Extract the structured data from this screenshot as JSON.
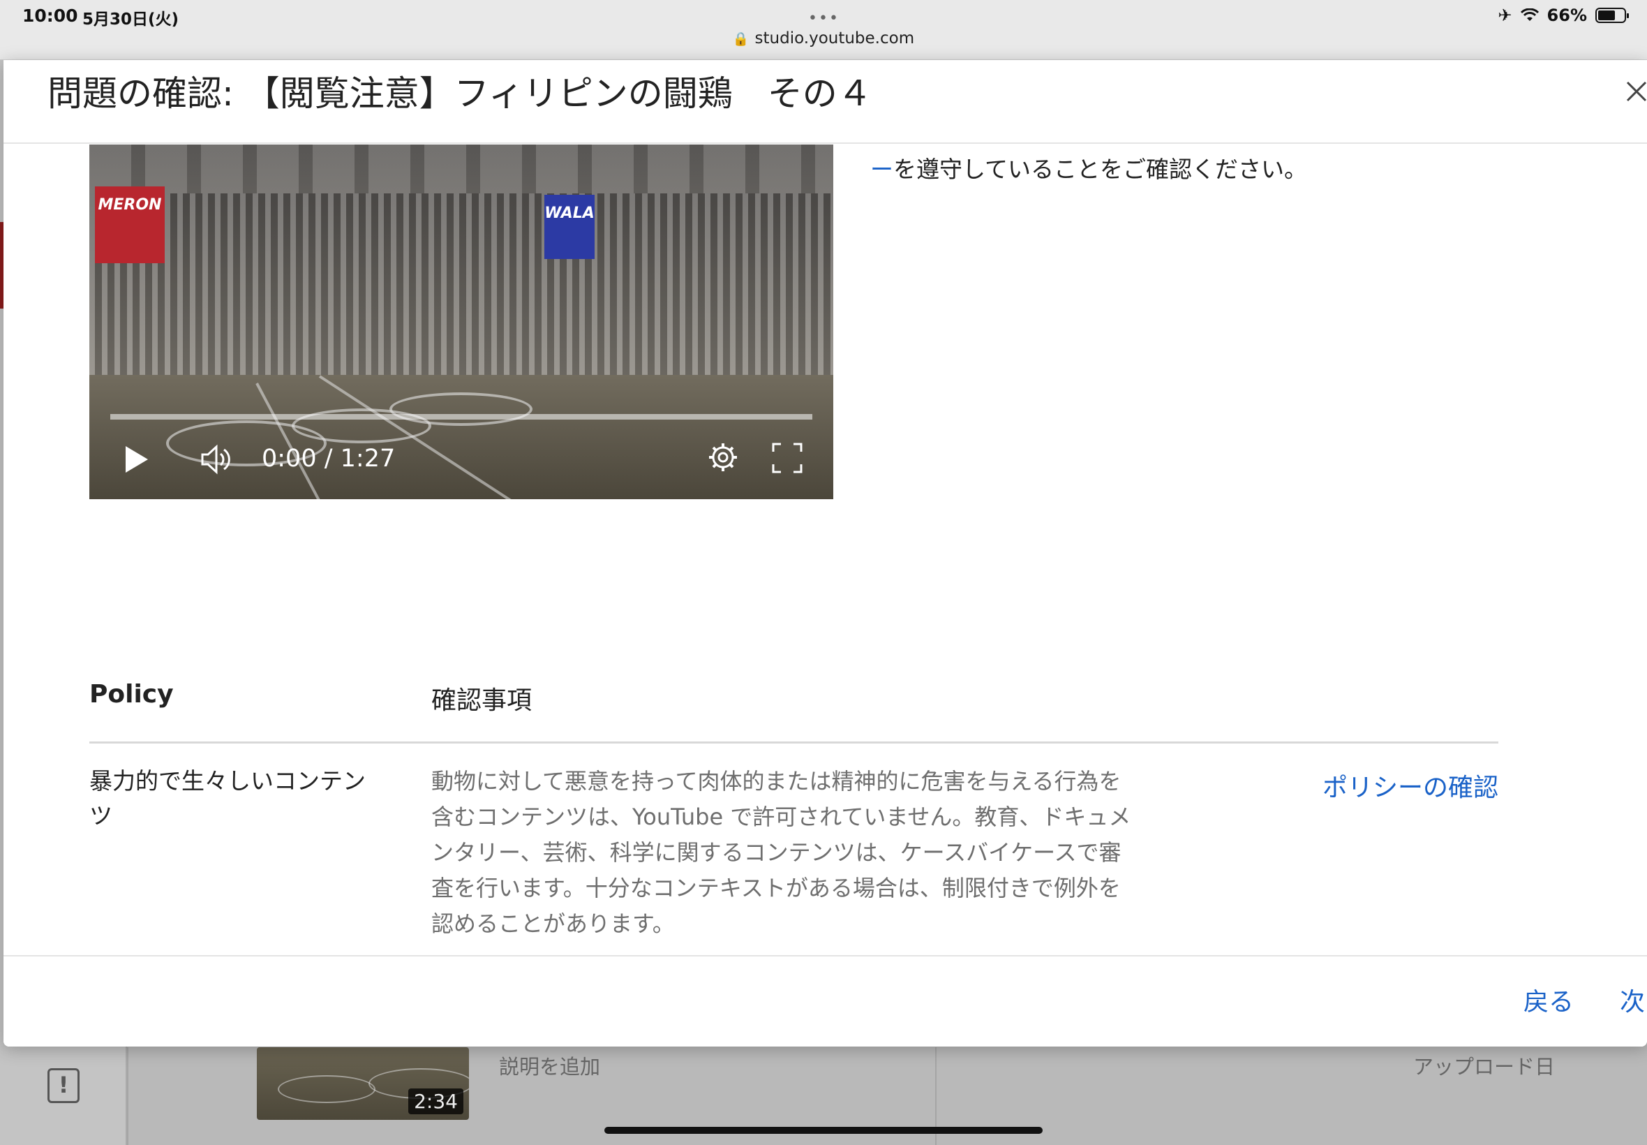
{
  "status_bar": {
    "time": "10:00",
    "date": "5月30日(火)",
    "url": "studio.youtube.com",
    "battery": "66%",
    "battery_level": 0.66
  },
  "dialog": {
    "title": "問題の確認: 【閲覧注意】フィリピンの闘鶏　その４",
    "notice_link": "ー",
    "notice_text": "を遵守していることをご確認ください。",
    "video": {
      "time_display": "0:00 / 1:27",
      "progress": 0.0,
      "banner_left": "MERON",
      "banner_right": "WALA"
    },
    "table": {
      "headers": {
        "policy": "Policy",
        "check": "確認事項"
      },
      "rows": [
        {
          "policy": "暴力的で生々しいコンテンツ",
          "description": "動物に対して悪意を持って肉体的または精神的に危害を与える行為を含むコンテンツは、YouTube で許可されていません。教育、ドキュメンタリー、芸術、科学に関するコンテンツは、ケースバイケースで審査を行います。十分なコンテキストがある場合は、制限付きで例外を認めることがあります。",
          "link": "ポリシーの確認"
        }
      ]
    },
    "footer": {
      "back": "戻る",
      "next": "次"
    }
  },
  "background": {
    "thumb_duration": "2:34",
    "description_placeholder": "説明を追加",
    "upload_date_label": "アップロード日"
  },
  "colors": {
    "link": "#1a62c8",
    "accent_red": "#8c1c1c"
  }
}
